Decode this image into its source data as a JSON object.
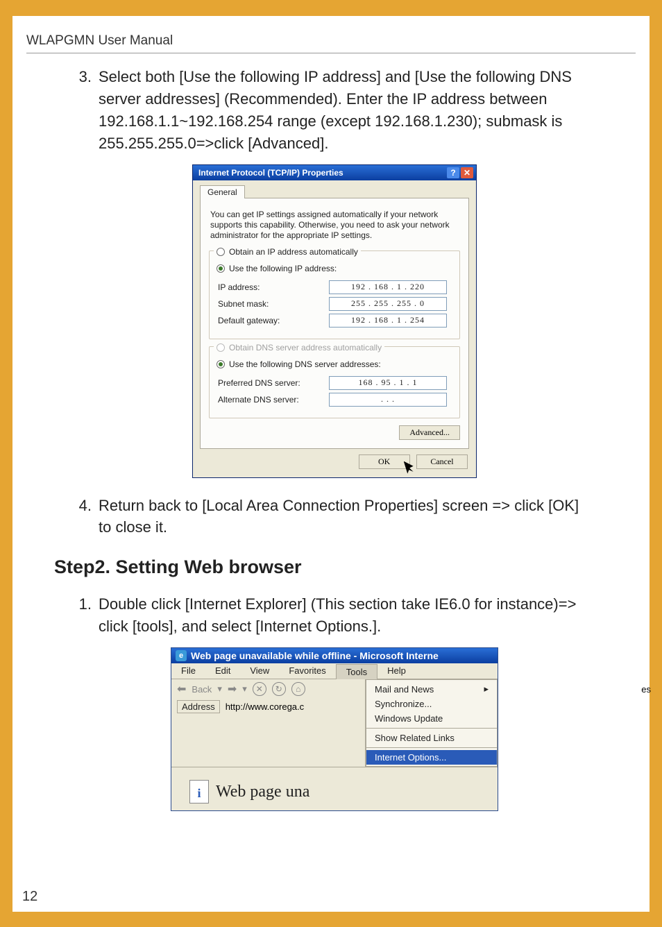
{
  "header": "WLAPGMN User Manual",
  "item3": {
    "num": "3.",
    "text": "Select both [Use the following IP address] and [Use the following DNS server addresses] (Recommended). Enter the IP address between 192.168.1.1~192.168.254 range (except 192.168.1.230); submask is 255.255.255.0=>click [Advanced]."
  },
  "tcpip": {
    "title": "Internet Protocol (TCP/IP) Properties",
    "tab": "General",
    "desc": "You can get IP settings assigned automatically if your network supports this capability. Otherwise, you need to ask your network administrator for the appropriate IP settings.",
    "radio_auto_ip": "Obtain an IP address automatically",
    "radio_use_ip": "Use the following IP address:",
    "ip_label": "IP address:",
    "ip_value": "192 . 168 .   1   . 220",
    "subnet_label": "Subnet mask:",
    "subnet_value": "255 . 255 . 255 .   0",
    "gateway_label": "Default gateway:",
    "gateway_value": "192 . 168 .   1   . 254",
    "radio_auto_dns": "Obtain DNS server address automatically",
    "radio_use_dns": "Use the following DNS server addresses:",
    "pref_dns_label": "Preferred DNS server:",
    "pref_dns_value": "168 .  95  .   1   .   1",
    "alt_dns_label": "Alternate DNS server:",
    "alt_dns_value": ".       .       .",
    "advanced": "Advanced...",
    "ok": "OK",
    "cancel": "Cancel"
  },
  "item4": {
    "num": "4.",
    "text": "Return back to [Local Area Connection Properties] screen => click [OK] to close it."
  },
  "step2_heading": "Step2. Setting Web browser",
  "item1b": {
    "num": "1.",
    "text": "Double click [Internet Explorer] (This section take IE6.0 for instance)=> click [tools], and select [Internet Options.]."
  },
  "ie": {
    "title": "Web page unavailable while offline - Microsoft Interne",
    "menu": {
      "file": "File",
      "edit": "Edit",
      "view": "View",
      "fav": "Favorites",
      "tools": "Tools",
      "help": "Help"
    },
    "back": "Back",
    "address_label": "Address",
    "address_value": "http://www.corega.c",
    "dd": {
      "mail": "Mail and News",
      "sync": "Synchronize...",
      "wu": "Windows Update",
      "related": "Show Related Links",
      "iopts": "Internet Options..."
    },
    "page_text": "Web page una",
    "truncated_es": "es"
  },
  "page_number": "12"
}
